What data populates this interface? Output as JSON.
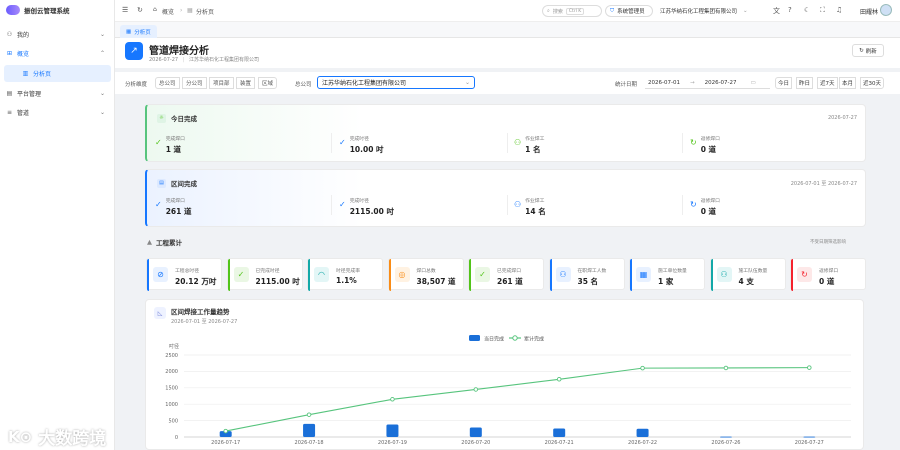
{
  "app": {
    "title": "振创云管理系统"
  },
  "sidebar": {
    "items": [
      {
        "label": "我的",
        "icon": "user-icon"
      },
      {
        "label": "概览",
        "icon": "grid-icon"
      },
      {
        "label": "分析页",
        "icon": "analysis-icon"
      },
      {
        "label": "平台管理",
        "icon": "platform-icon"
      },
      {
        "label": "管道",
        "icon": "pipe-icon"
      }
    ]
  },
  "topbar": {
    "breadcrumb": [
      "概览",
      "分析页"
    ],
    "search_label": "搜索",
    "search_kbd": "Ctrl K",
    "tenant_label": "系统管理员",
    "company": "江苏华纳石化工程集团有限公司",
    "user": "田耀林"
  },
  "tab": {
    "label": "分析页"
  },
  "page": {
    "title": "管道焊接分析",
    "date": "2026-07-27",
    "company": "江苏华纳石化工程集团有限公司",
    "refresh_label": "刷新"
  },
  "filter": {
    "dimension_label": "分析维度",
    "dimensions": [
      "总公司",
      "分公司",
      "项目部",
      "装置",
      "区域"
    ],
    "company_label": "总公司",
    "company_value": "江苏华纳石化工程集团有限公司",
    "date_label": "统计日期",
    "start_date": "2026-07-01",
    "end_date": "2026-07-27",
    "quick": [
      "今日",
      "昨日",
      "近7天",
      "本月",
      "近30天"
    ]
  },
  "today": {
    "title": "今日完成",
    "date": "2026-07-27",
    "stats": [
      {
        "label": "完成焊口",
        "value": "1 道",
        "icon": "check-circle-icon"
      },
      {
        "label": "完成吋径",
        "value": "10.00 吋",
        "icon": "check-circle-icon"
      },
      {
        "label": "作业焊工",
        "value": "1 名",
        "icon": "users-icon"
      },
      {
        "label": "返修焊口",
        "value": "0 道",
        "icon": "refresh-icon"
      }
    ]
  },
  "range": {
    "title": "区间完成",
    "date": "2026-07-01 至 2026-07-27",
    "stats": [
      {
        "label": "完成焊口",
        "value": "261 道",
        "icon": "check-circle-icon"
      },
      {
        "label": "完成吋径",
        "value": "2115.00 吋",
        "icon": "check-circle-icon"
      },
      {
        "label": "作业焊工",
        "value": "14 名",
        "icon": "users-icon"
      },
      {
        "label": "返修焊口",
        "value": "0 道",
        "icon": "refresh-icon"
      }
    ]
  },
  "cumulative": {
    "title": "工程累计",
    "note": "不受日期筛选影响",
    "kpis": [
      {
        "label": "工程总吋径",
        "value": "20.12 万吋",
        "color": "#1677ff",
        "bg": "#e8f1ff",
        "icon": "ban-icon"
      },
      {
        "label": "已完成吋径",
        "value": "2115.00 吋",
        "color": "#52c41a",
        "bg": "#eaf7e4",
        "icon": "shield-check-icon"
      },
      {
        "label": "吋径完成率",
        "value": "1.1%",
        "color": "#13a8a8",
        "bg": "#e3f6f6",
        "icon": "gauge-icon"
      },
      {
        "label": "焊口总数",
        "value": "38,507 道",
        "color": "#fa8c16",
        "bg": "#fff2e2",
        "icon": "target-icon"
      },
      {
        "label": "已完成焊口",
        "value": "261 道",
        "color": "#52c41a",
        "bg": "#eaf7e4",
        "icon": "shield-check-icon"
      },
      {
        "label": "在职焊工人数",
        "value": "35 名",
        "color": "#1677ff",
        "bg": "#e8f1ff",
        "icon": "user-icon"
      },
      {
        "label": "施工单位数量",
        "value": "1 家",
        "color": "#1677ff",
        "bg": "#e8f1ff",
        "icon": "building-icon"
      },
      {
        "label": "施工队伍数量",
        "value": "4 支",
        "color": "#13a8a8",
        "bg": "#e3f6f6",
        "icon": "team-icon"
      },
      {
        "label": "返修焊口",
        "value": "0 道",
        "color": "#f5222d",
        "bg": "#fde8e8",
        "icon": "refresh-icon"
      }
    ]
  },
  "trend": {
    "title": "区间焊接工作量趋势",
    "subtitle": "2026-07-01 至 2026-07-27"
  },
  "chart_data": {
    "type": "bar",
    "categories": [
      "2026-07-17",
      "2026-07-18",
      "2026-07-19",
      "2026-07-20",
      "2026-07-21",
      "2026-07-22",
      "2026-07-26",
      "2026-07-27"
    ],
    "ylabel": "吋径",
    "ylim": [
      0,
      2500
    ],
    "yticks": [
      0,
      500,
      1000,
      1500,
      2000,
      2500
    ],
    "series": [
      {
        "name": "当日完成",
        "type": "bar",
        "color": "#1a6fd8",
        "values": [
          180,
          400,
          380,
          290,
          260,
          250,
          10,
          10
        ]
      },
      {
        "name": "累计完成",
        "type": "line",
        "color": "#57c47d",
        "values": [
          180,
          680,
          1150,
          1450,
          1760,
          2100,
          2105,
          2115
        ]
      }
    ],
    "legend": "top-center",
    "grid": true
  },
  "watermark": {
    "text": "大数跨境"
  }
}
